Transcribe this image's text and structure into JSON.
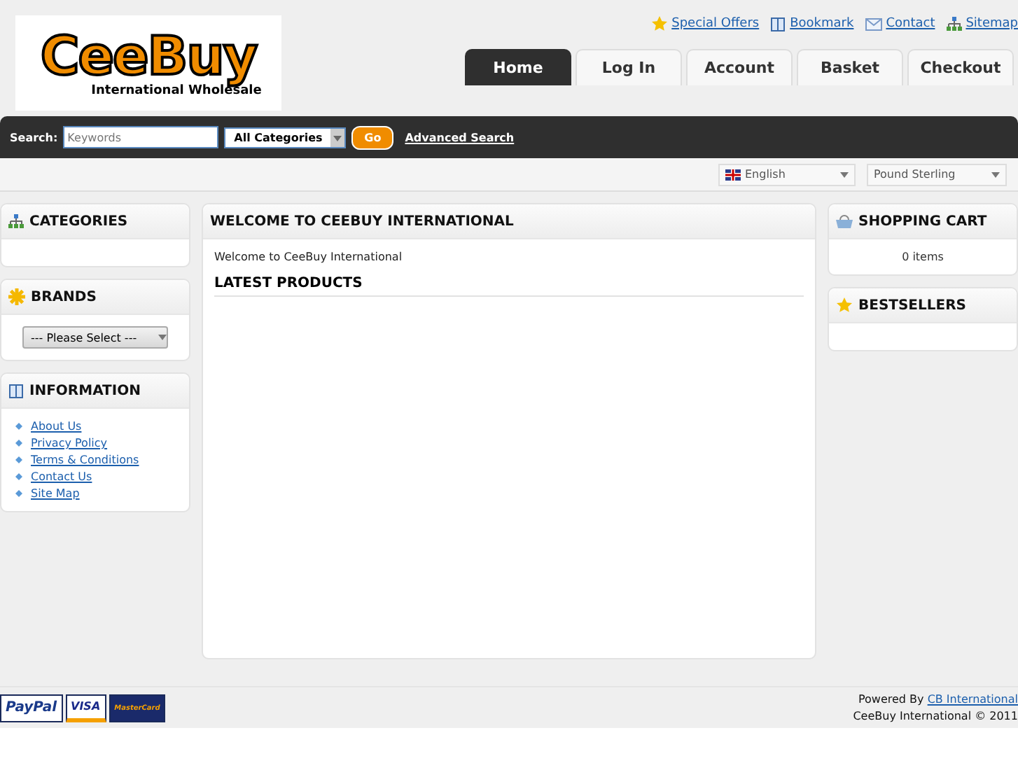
{
  "logo": {
    "name": "CeeBuy",
    "tagline": "International Wholesale"
  },
  "top_links": [
    {
      "label": "Special Offers"
    },
    {
      "label": "Bookmark"
    },
    {
      "label": "Contact"
    },
    {
      "label": "Sitemap"
    }
  ],
  "tabs": [
    {
      "label": "Home",
      "selected": true
    },
    {
      "label": "Log In",
      "selected": false
    },
    {
      "label": "Account",
      "selected": false
    },
    {
      "label": "Basket",
      "selected": false
    },
    {
      "label": "Checkout",
      "selected": false
    }
  ],
  "search": {
    "label": "Search:",
    "placeholder": "Keywords",
    "category": "All Categories",
    "button": "Go",
    "advanced": "Advanced Search"
  },
  "language": "English",
  "currency": "Pound Sterling",
  "left": [
    {
      "kind": "empty",
      "title": "CATEGORIES"
    },
    {
      "kind": "select",
      "title": "BRANDS",
      "value": "--- Please Select ---"
    },
    {
      "kind": "links",
      "title": "INFORMATION",
      "links": [
        "About Us",
        "Privacy Policy",
        "Terms & Conditions",
        "Contact Us",
        "Site Map"
      ]
    }
  ],
  "main": {
    "title": "WELCOME TO CEEBUY INTERNATIONAL",
    "text": "Welcome to CeeBuy International",
    "subtitle": "LATEST PRODUCTS"
  },
  "right": [
    {
      "kind": "text",
      "title": "SHOPPING CART",
      "text": "0 items"
    },
    {
      "kind": "empty",
      "title": "BESTSELLERS"
    }
  ],
  "footer": {
    "payments": [
      "PayPal",
      "VISA",
      "MasterCard"
    ],
    "powered": "Powered By",
    "powered_link": "CB International",
    "copyright": "CeeBuy International © 2011"
  }
}
